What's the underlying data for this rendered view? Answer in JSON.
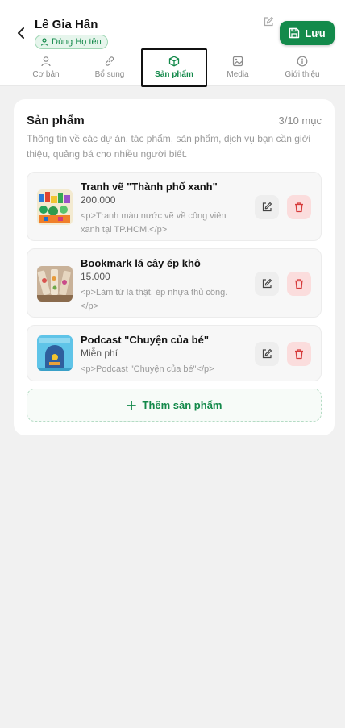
{
  "header": {
    "user_name": "Lê Gia Hân",
    "badge_label": "Dùng Họ tên",
    "save_label": "Lưu",
    "colors": {
      "accent": "#138a4b",
      "badge_bg": "#e6f5ec"
    }
  },
  "tabs": [
    {
      "label": "Cơ bản",
      "icon": "user-icon"
    },
    {
      "label": "Bổ sung",
      "icon": "link-icon"
    },
    {
      "label": "Sản phẩm",
      "icon": "box-icon",
      "active": true
    },
    {
      "label": "Media",
      "icon": "image-icon"
    },
    {
      "label": "Giới thiệu",
      "icon": "info-icon"
    }
  ],
  "section": {
    "title": "Sản phẩm",
    "count": "3/10 mục",
    "description": "Thông tin về các dự án, tác phẩm, sản phẩm, dịch vụ bạn cần giới thiệu, quảng bá cho nhiều người biết."
  },
  "products": [
    {
      "name": "Tranh vẽ \"Thành phố xanh\"",
      "price": "200.000",
      "description": "<p>Tranh màu nước vẽ về công viên xanh tại TP.HCM.</p>"
    },
    {
      "name": "Bookmark lá cây ép khô",
      "price": "15.000",
      "description": "<p>Làm từ lá thật, ép nhựa thủ công.</p>"
    },
    {
      "name": "Podcast \"Chuyện của bé\"",
      "price": "Miễn phí",
      "description": "<p>Podcast \"Chuyện của bé\"</p>"
    }
  ],
  "add_label": "Thêm sản phẩm"
}
